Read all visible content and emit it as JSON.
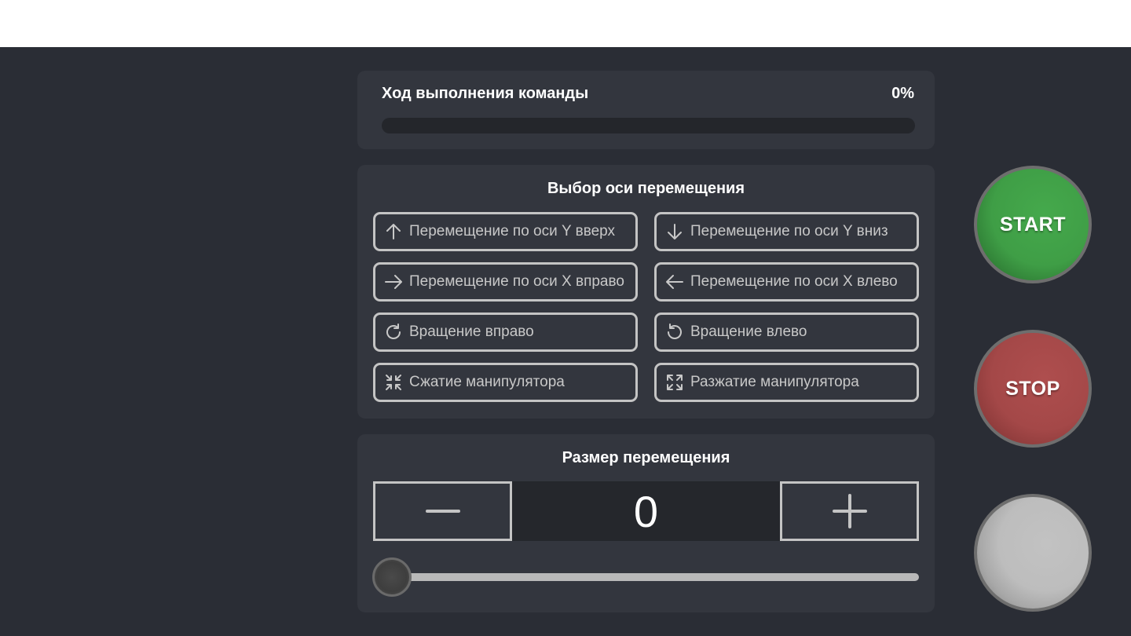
{
  "progress": {
    "title": "Ход выполнения команды",
    "value_text": "0%",
    "value": 0
  },
  "axis": {
    "title": "Выбор оси перемещения",
    "buttons": [
      {
        "label": "Перемещение по оси Y вверх",
        "icon": "arrow-up-icon"
      },
      {
        "label": "Перемещение по оси Y вниз",
        "icon": "arrow-down-icon"
      },
      {
        "label": "Перемещение по оси X вправо",
        "icon": "arrow-right-icon"
      },
      {
        "label": "Перемещение по оси X влево",
        "icon": "arrow-left-icon"
      },
      {
        "label": "Вращение вправо",
        "icon": "rotate-right-icon"
      },
      {
        "label": "Вращение влево",
        "icon": "rotate-left-icon"
      },
      {
        "label": "Сжатие манипулятора",
        "icon": "compress-icon"
      },
      {
        "label": "Разжатие манипулятора",
        "icon": "expand-icon"
      }
    ]
  },
  "size": {
    "title": "Размер перемещения",
    "value": "0",
    "minus_icon": "minus-icon",
    "plus_icon": "plus-icon",
    "slider_value": 0
  },
  "controls": {
    "start_label": "START",
    "stop_label": "STOP",
    "start_color": "#3f9e46",
    "stop_color": "#a44848",
    "blank_color": "#bdbdbd"
  },
  "colors": {
    "background": "#2a2d35",
    "panel": "#33363e",
    "border": "#c4c4c4"
  }
}
